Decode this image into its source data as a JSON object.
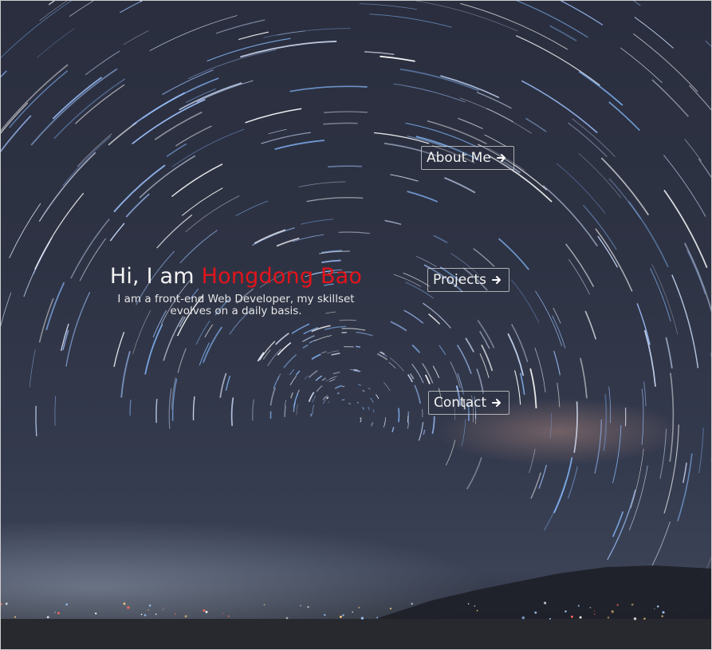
{
  "hero": {
    "greeting": "Hi, I am ",
    "name": "Hongdong Bao",
    "subtitle": "I am a front-end Web Developer, my skillset evolves on a daily basis."
  },
  "nav": {
    "about": "About Me",
    "projects": "Projects",
    "contact": "Contact"
  },
  "icons": {
    "arrow": "arrow-right-icon"
  },
  "colors": {
    "name_accent": "#e3141b",
    "text": "#f2f2f2",
    "sky": "#2e3344"
  }
}
